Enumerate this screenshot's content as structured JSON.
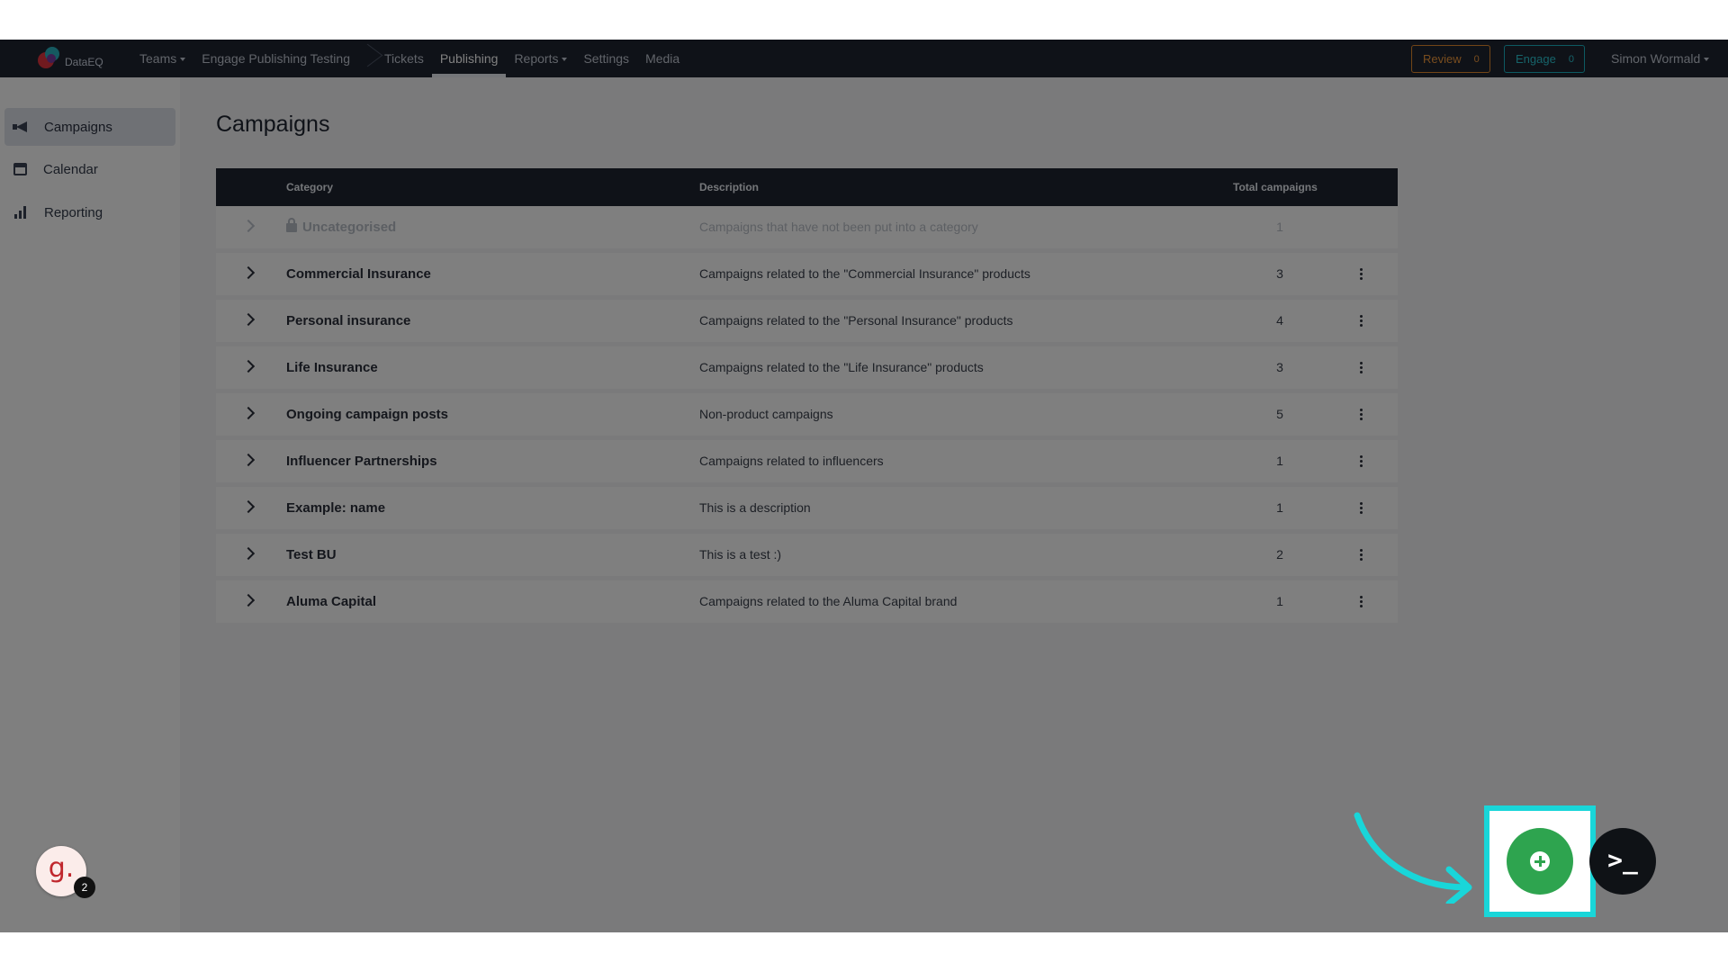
{
  "app": {
    "brand": "DataEQ"
  },
  "nav": {
    "items": [
      {
        "label": "Teams",
        "dropdown": true
      },
      {
        "label": "Engage Publishing Testing",
        "dropdown": false
      },
      {
        "label": "Tickets",
        "dropdown": false
      },
      {
        "label": "Publishing",
        "dropdown": false,
        "active": true
      },
      {
        "label": "Reports",
        "dropdown": true
      },
      {
        "label": "Settings",
        "dropdown": false
      },
      {
        "label": "Media",
        "dropdown": false
      }
    ],
    "review": {
      "label": "Review",
      "count": "0"
    },
    "engage": {
      "label": "Engage",
      "count": "0"
    },
    "user": "Simon Wormald"
  },
  "sidebar": {
    "items": [
      {
        "label": "Campaigns",
        "icon": "megaphone-icon",
        "active": true
      },
      {
        "label": "Calendar",
        "icon": "calendar-icon",
        "active": false
      },
      {
        "label": "Reporting",
        "icon": "bar-chart-icon",
        "active": false
      }
    ]
  },
  "main": {
    "title": "Campaigns",
    "table": {
      "columns": {
        "category": "Category",
        "description": "Description",
        "total": "Total campaigns"
      },
      "rows": [
        {
          "category": "Uncategorised",
          "description": "Campaigns that have not been put into a category",
          "total": "1",
          "locked": true
        },
        {
          "category": "Commercial Insurance",
          "description": "Campaigns related to the \"Commercial Insurance\" products",
          "total": "3"
        },
        {
          "category": "Personal insurance",
          "description": "Campaigns related to the \"Personal Insurance\" products",
          "total": "4"
        },
        {
          "category": "Life Insurance",
          "description": "Campaigns related to the \"Life Insurance\" products",
          "total": "3"
        },
        {
          "category": "Ongoing campaign posts",
          "description": "Non-product campaigns",
          "total": "5"
        },
        {
          "category": "Influencer Partnerships",
          "description": "Campaigns related to influencers",
          "total": "1"
        },
        {
          "category": "Example: name",
          "description": "This is a description",
          "total": "1"
        },
        {
          "category": "Test BU",
          "description": "This is a test :)",
          "total": "2"
        },
        {
          "category": "Aluma Capital",
          "description": "Campaigns related to the Aluma Capital brand",
          "total": "1"
        }
      ]
    }
  },
  "widgets": {
    "g_letter": "g.",
    "g_badge": "2",
    "terminal_symbol": ">_",
    "highlight_color": "#19d6d9",
    "add_button_color": "#2ea44f"
  }
}
